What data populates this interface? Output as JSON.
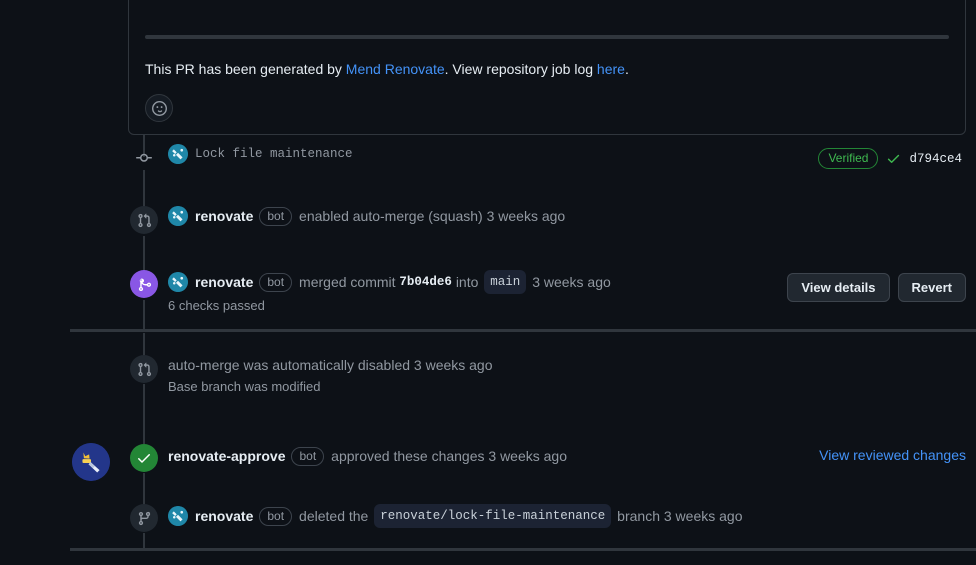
{
  "comment": {
    "generated_prefix": "This PR has been generated by ",
    "renovate_link": "Mend Renovate",
    "generated_middle": ". View repository job log ",
    "here_link": "here",
    "generated_suffix": ".",
    "reaction_icon": "smiley-icon"
  },
  "timeline": {
    "commit_row": {
      "icon": "git-commit-icon",
      "avatar": "renovate-avatar",
      "message": "Lock file maintenance",
      "verified_label": "Verified",
      "check_icon": "check-icon",
      "sha": "d794ce4"
    },
    "automerge_enabled_row": {
      "icon": "auto-merge-icon",
      "avatar": "renovate-avatar",
      "actor": "renovate",
      "bot_tag": "bot",
      "text": "enabled auto-merge (squash) 3 weeks ago"
    },
    "merged_row": {
      "icon": "git-merge-icon",
      "avatar": "renovate-avatar",
      "actor": "renovate",
      "bot_tag": "bot",
      "text_before": "merged commit",
      "sha": "7b04de6",
      "text_into": "into",
      "branch": "main",
      "time": "3 weeks ago",
      "sub_text": "6 checks passed",
      "view_details_label": "View details",
      "revert_label": "Revert"
    },
    "automerge_disabled_row": {
      "icon": "auto-merge-icon",
      "text": "auto-merge was automatically disabled 3 weeks ago",
      "sub_text": "Base branch was modified"
    },
    "approved_row": {
      "big_avatar": "renovate-approve-avatar",
      "icon": "check-circle-icon",
      "actor": "renovate-approve",
      "bot_tag": "bot",
      "text": "approved these changes 3 weeks ago",
      "review_link": "View reviewed changes"
    },
    "branch_deleted_row": {
      "icon": "git-branch-icon",
      "avatar": "renovate-avatar",
      "actor": "renovate",
      "bot_tag": "bot",
      "text_before": "deleted the",
      "branch": "renovate/lock-file-maintenance",
      "text_after": "branch 3 weeks ago"
    }
  },
  "colors": {
    "background": "#0d1117",
    "border": "#30363d",
    "link": "#4493f8",
    "success": "#3fb950",
    "merged": "#8957e5",
    "muted": "#9198a1"
  }
}
